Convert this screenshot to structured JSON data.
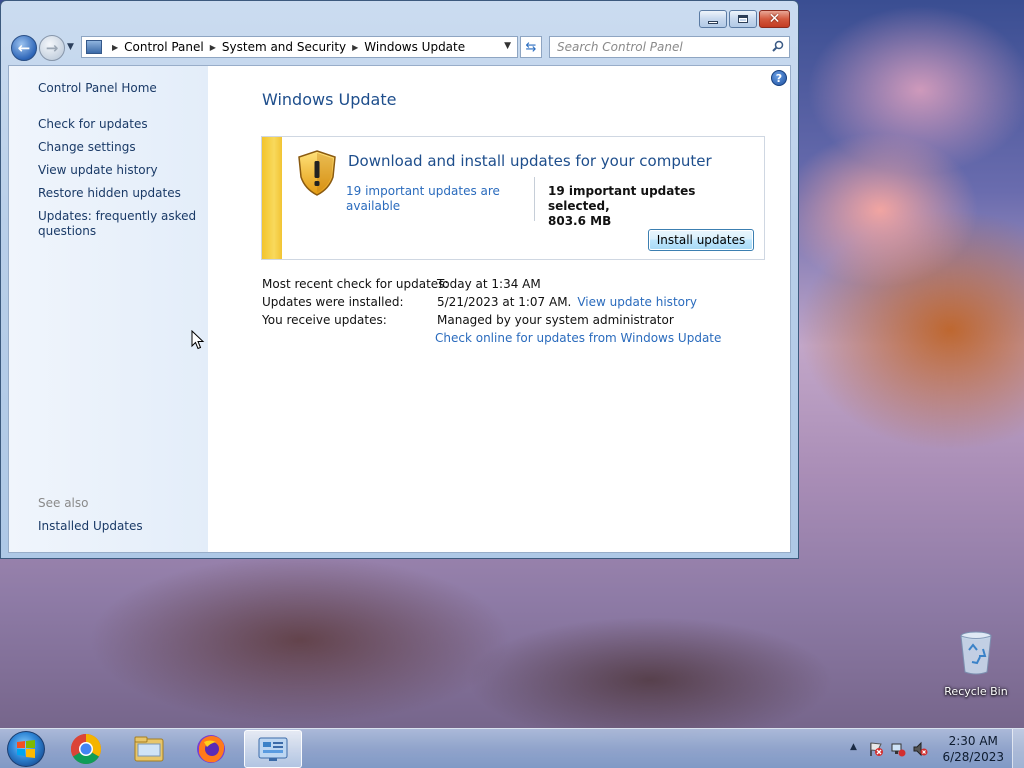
{
  "window": {
    "buttons": {
      "minimize": "minimize-icon",
      "maximize": "maximize-icon",
      "close": "close-icon"
    }
  },
  "nav": {
    "breadcrumbs": [
      "Control Panel",
      "System and Security",
      "Windows Update"
    ],
    "search_placeholder": "Search Control Panel"
  },
  "sidebar": {
    "home": "Control Panel Home",
    "items": [
      {
        "label": "Check for updates"
      },
      {
        "label": "Change settings"
      },
      {
        "label": "View update history"
      },
      {
        "label": "Restore hidden updates"
      },
      {
        "label": "Updates: frequently asked questions"
      }
    ],
    "see_also_title": "See also",
    "see_also_items": [
      {
        "label": "Installed Updates"
      }
    ]
  },
  "main": {
    "title": "Windows Update",
    "panel": {
      "heading": "Download and install updates for your computer",
      "available_link": "19 important updates are available",
      "selected_line1": "19 important updates selected,",
      "selected_line2": "803.6 MB",
      "install_button": "Install updates",
      "accent_color": "#f3c42c"
    },
    "info": [
      {
        "label": "Most recent check for updates:",
        "value": "Today at 1:34 AM"
      },
      {
        "label": "Updates were installed:",
        "value": "5/21/2023 at 1:07 AM.",
        "link": "View update history"
      },
      {
        "label": "You receive updates:",
        "value": "Managed by your system administrator"
      }
    ],
    "online_link": "Check online for updates from Windows Update"
  },
  "desktop": {
    "recycle_bin": "Recycle Bin"
  },
  "taskbar": {
    "apps": [
      "chrome-icon",
      "file-explorer-icon",
      "firefox-icon",
      "control-panel-icon"
    ],
    "clock_time": "2:30 AM",
    "clock_date": "6/28/2023"
  }
}
